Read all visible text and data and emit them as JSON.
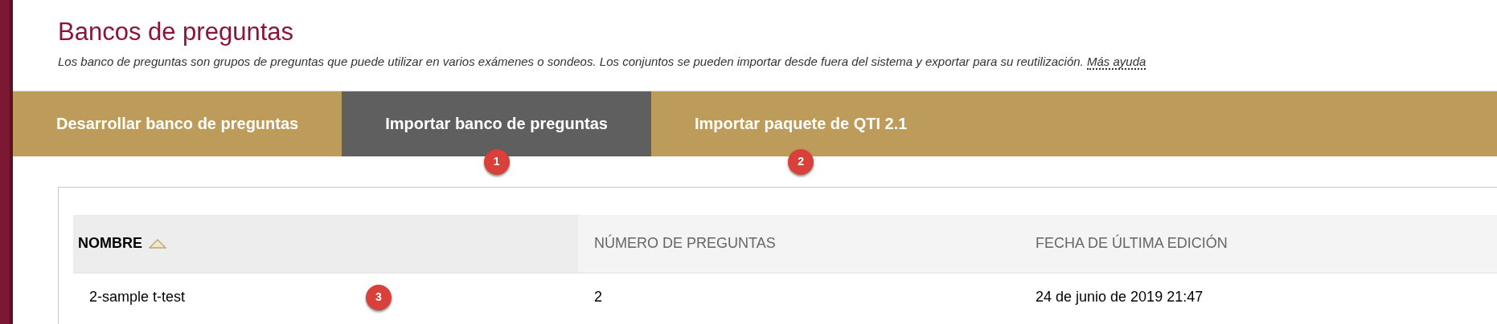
{
  "page": {
    "title": "Bancos de preguntas",
    "description": "Los banco de preguntas son grupos de preguntas que puede utilizar en varios exámenes o sondeos. Los conjuntos se pueden importar desde fuera del sistema y exportar para su reutilización.",
    "help_link": "Más ayuda"
  },
  "tabs": [
    {
      "label": "Desarrollar banco de preguntas",
      "selected": false
    },
    {
      "label": "Importar banco de preguntas",
      "selected": true,
      "callout": "1"
    },
    {
      "label": "Importar paquete de QTI 2.1",
      "selected": false,
      "callout": "2"
    }
  ],
  "table": {
    "columns": [
      {
        "label": "NOMBRE",
        "sorted": true
      },
      {
        "label": "NÚMERO DE PREGUNTAS",
        "sorted": false
      },
      {
        "label": "FECHA DE ÚLTIMA EDICIÓN",
        "sorted": false
      }
    ],
    "rows": [
      {
        "cells": [
          "2-sample t-test",
          "2",
          "24 de junio de 2019 21:47"
        ],
        "callout": "3"
      }
    ]
  }
}
